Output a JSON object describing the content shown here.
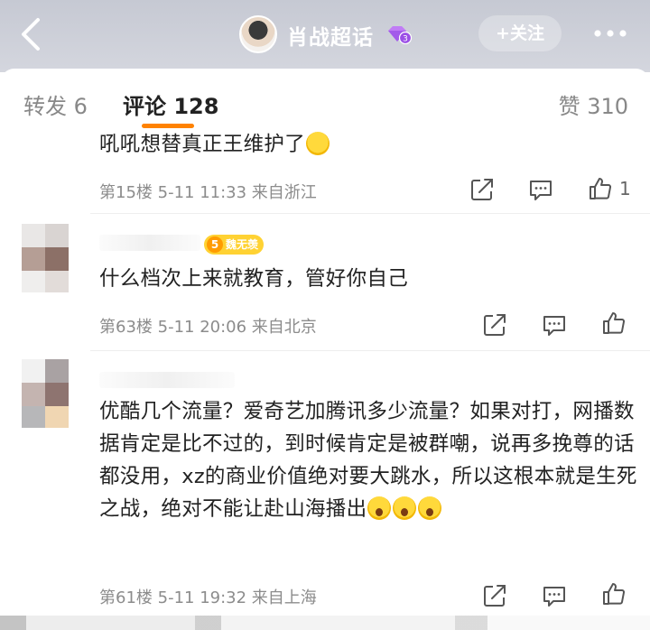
{
  "header": {
    "title": "肖战超话",
    "badge_level": "3",
    "follow_label": "+关注",
    "colors": {
      "bar": "#c6c9d3",
      "badge": "#b16cf0"
    }
  },
  "tabs": {
    "repost": "转发 6",
    "comment": "评论 128",
    "like": "赞 310",
    "accent": "#ff8200"
  },
  "comments": [
    {
      "text": "吼吼想替真正王维护了",
      "emoji": "wink-emoji",
      "meta": "第15楼 5-11 11:33 来自浙江",
      "likes": "1"
    },
    {
      "vip_level": "5",
      "vip_label": "魏无羡",
      "text": "什么档次上来就教育，管好你自己",
      "meta": "第63楼 5-11 20:06 来自北京",
      "likes": ""
    },
    {
      "text": "优酷几个流量？爱奇艺加腾讯多少流量？如果对打，网播数据肯定是比不过的，到时候肯定是被群嘲，说再多挽尊的话都没用，xz的商业价值绝对要大跳水，所以这根本就是生死之战，绝对不能让赴山海播出",
      "emoji": "shocked-emoji",
      "meta": "第61楼 5-11 19:32 来自上海",
      "likes": ""
    }
  ]
}
